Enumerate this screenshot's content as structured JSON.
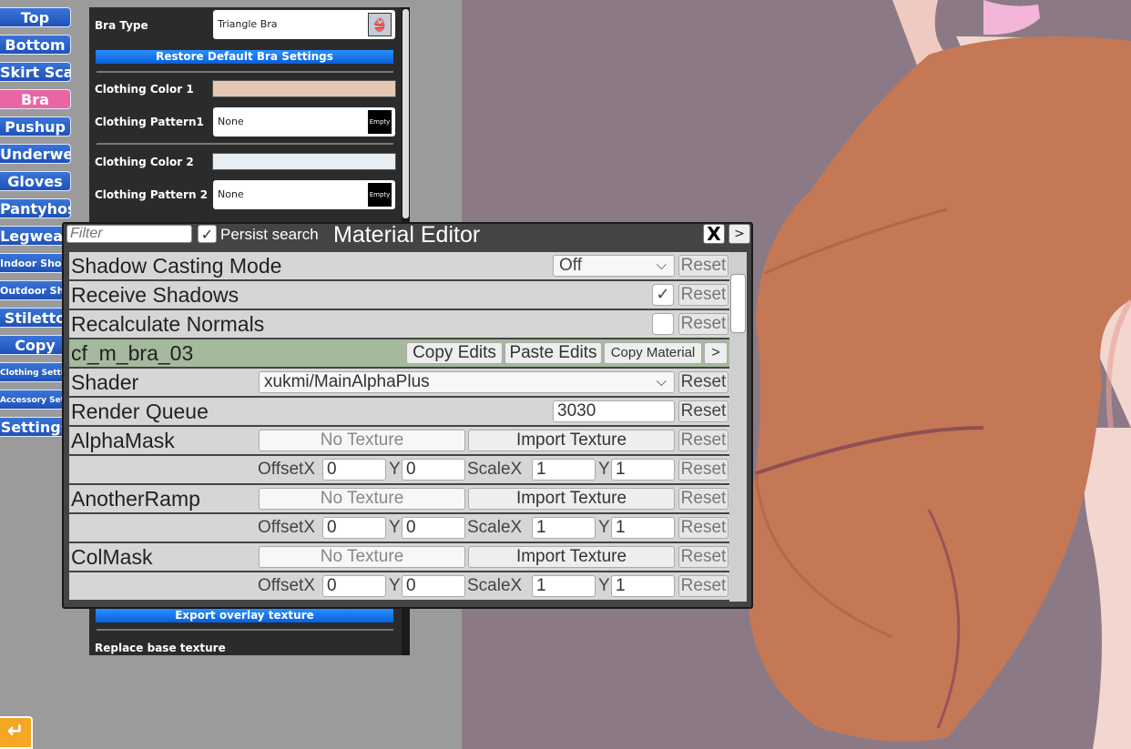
{
  "categories": [
    {
      "label": "Top",
      "active": false
    },
    {
      "label": "Bottom",
      "active": false
    },
    {
      "label": "Skirt Scale",
      "active": false
    },
    {
      "label": "Bra",
      "active": true
    },
    {
      "label": "Pushup",
      "active": false
    },
    {
      "label": "Underwear",
      "active": false
    },
    {
      "label": "Gloves",
      "active": false
    },
    {
      "label": "Pantyhose",
      "active": false
    },
    {
      "label": "Legwear",
      "active": false
    },
    {
      "label": "Indoor Shoes",
      "active": false
    },
    {
      "label": "Outdoor Shoes",
      "active": false
    },
    {
      "label": "Stiletto",
      "active": false
    },
    {
      "label": "Copy",
      "active": false
    },
    {
      "label": "Clothing Settings",
      "active": false
    },
    {
      "label": "Accessory Settings",
      "active": false
    },
    {
      "label": "Settings",
      "active": false
    }
  ],
  "bra_panel": {
    "bra_type_label": "Bra Type",
    "bra_type_value": "Triangle Bra",
    "restore_label": "Restore Default Bra Settings",
    "color1_label": "Clothing Color 1",
    "color1": "#e6c7b3",
    "pattern1_label": "Clothing Pattern1",
    "pattern1_value": "None",
    "pattern1_thumb": "Empty",
    "color2_label": "Clothing Color 2",
    "color2": "#e9eef2",
    "pattern2_label": "Clothing Pattern 2",
    "pattern2_value": "None",
    "pattern2_thumb": "Empty",
    "export_label": "Export overlay texture",
    "replace_label": "Replace base texture"
  },
  "material_editor": {
    "filter_placeholder": "Filter",
    "persist_label": "Persist search",
    "title": "Material Editor",
    "close_glyph": "X",
    "more_glyph": ">",
    "reset_label": "Reset",
    "shadow_casting_label": "Shadow Casting Mode",
    "shadow_casting_value": "Off",
    "receive_shadows_label": "Receive Shadows",
    "recalc_normals_label": "Recalculate Normals",
    "material_name": "cf_m_bra_03",
    "copy_edits": "Copy Edits",
    "paste_edits": "Paste Edits",
    "copy_material": "Copy Material",
    "material_more": ">",
    "shader_label": "Shader",
    "shader_value": "xukmi/MainAlphaPlus",
    "render_queue_label": "Render Queue",
    "render_queue_value": "3030",
    "no_texture": "No Texture",
    "import_texture": "Import Texture",
    "offsetx_label": "OffsetX",
    "y_label": "Y",
    "scalex_label": "ScaleX",
    "textures": [
      {
        "name": "AlphaMask",
        "offset_x": "0",
        "offset_y": "0",
        "scale_x": "1",
        "scale_y": "1"
      },
      {
        "name": "AnotherRamp",
        "offset_x": "0",
        "offset_y": "0",
        "scale_x": "1",
        "scale_y": "1"
      },
      {
        "name": "ColMask",
        "offset_x": "0",
        "offset_y": "0",
        "scale_x": "1",
        "scale_y": "1"
      }
    ]
  }
}
